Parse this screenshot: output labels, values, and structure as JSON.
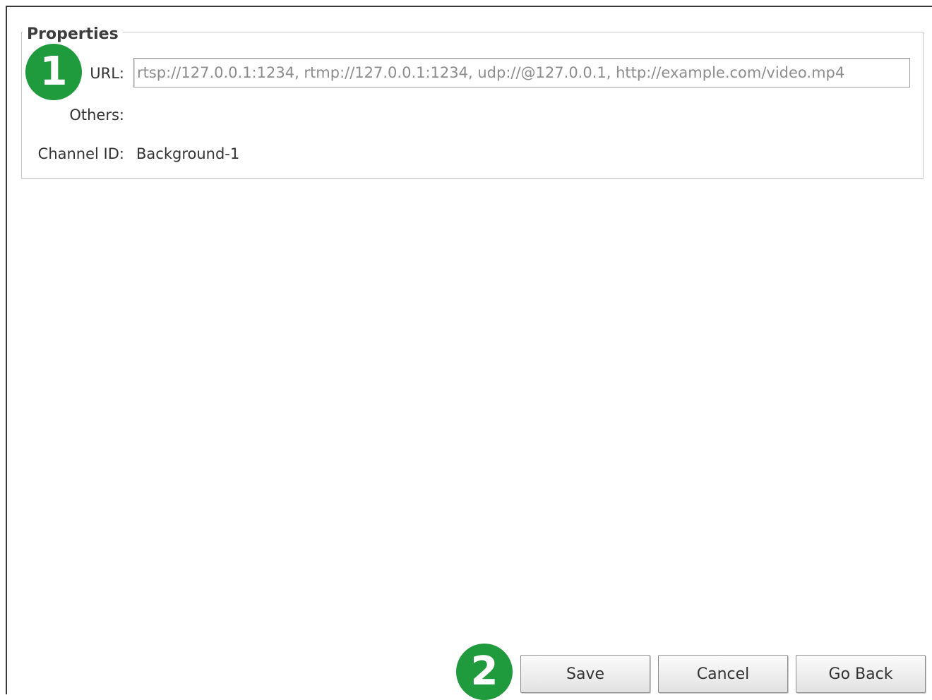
{
  "properties": {
    "legend": "Properties",
    "url_label": "URL:",
    "url_placeholder": "rtsp://127.0.0.1:1234, rtmp://127.0.0.1:1234, udp://@127.0.0.1, http://example.com/video.mp4",
    "url_value": "",
    "others_label": "Others:",
    "channel_id_label": "Channel ID:",
    "channel_id_value": "Background-1"
  },
  "callouts": {
    "first": "1",
    "second": "2",
    "color": "#1f9a3c"
  },
  "buttons": {
    "save": "Save",
    "cancel": "Cancel",
    "go_back": "Go Back"
  }
}
